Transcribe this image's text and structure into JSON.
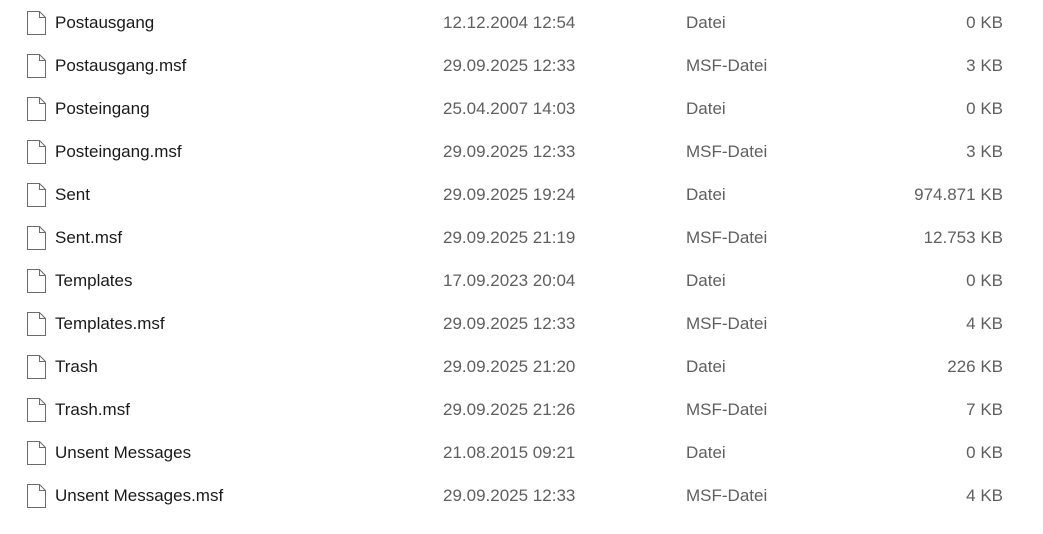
{
  "files": [
    {
      "name": "Postausgang",
      "date": "12.12.2004 12:54",
      "type": "Datei",
      "size": "0 KB",
      "icon": "file-icon"
    },
    {
      "name": "Postausgang.msf",
      "date": "29.09.2025 12:33",
      "type": "MSF-Datei",
      "size": "3 KB",
      "icon": "file-icon"
    },
    {
      "name": "Posteingang",
      "date": "25.04.2007 14:03",
      "type": "Datei",
      "size": "0 KB",
      "icon": "file-icon"
    },
    {
      "name": "Posteingang.msf",
      "date": "29.09.2025 12:33",
      "type": "MSF-Datei",
      "size": "3 KB",
      "icon": "file-icon"
    },
    {
      "name": "Sent",
      "date": "29.09.2025 19:24",
      "type": "Datei",
      "size": "974.871 KB",
      "icon": "file-icon"
    },
    {
      "name": "Sent.msf",
      "date": "29.09.2025 21:19",
      "type": "MSF-Datei",
      "size": "12.753 KB",
      "icon": "file-icon"
    },
    {
      "name": "Templates",
      "date": "17.09.2023 20:04",
      "type": "Datei",
      "size": "0 KB",
      "icon": "file-icon"
    },
    {
      "name": "Templates.msf",
      "date": "29.09.2025 12:33",
      "type": "MSF-Datei",
      "size": "4 KB",
      "icon": "file-icon"
    },
    {
      "name": "Trash",
      "date": "29.09.2025 21:20",
      "type": "Datei",
      "size": "226 KB",
      "icon": "file-icon"
    },
    {
      "name": "Trash.msf",
      "date": "29.09.2025 21:26",
      "type": "MSF-Datei",
      "size": "7 KB",
      "icon": "file-icon"
    },
    {
      "name": "Unsent Messages",
      "date": "21.08.2015 09:21",
      "type": "Datei",
      "size": "0 KB",
      "icon": "file-icon"
    },
    {
      "name": "Unsent Messages.msf",
      "date": "29.09.2025 12:33",
      "type": "MSF-Datei",
      "size": "4 KB",
      "icon": "file-icon"
    }
  ]
}
